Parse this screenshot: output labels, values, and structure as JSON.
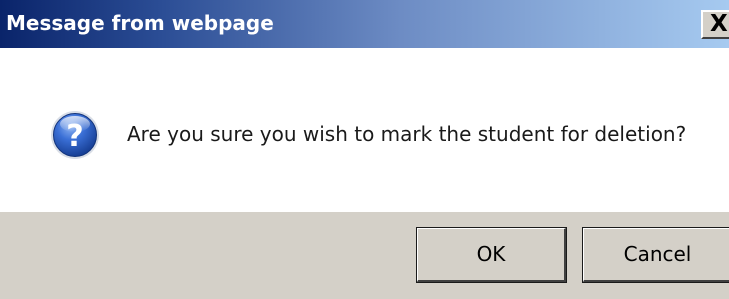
{
  "window": {
    "title": "Message from webpage",
    "close_symbol": "X"
  },
  "message": {
    "icon": "question-icon",
    "text": "Are you sure you wish to mark the student for deletion?"
  },
  "buttons": {
    "ok_label": "OK",
    "cancel_label": "Cancel"
  },
  "colors": {
    "title_gradient_start": "#0a246a",
    "title_gradient_end": "#a6caf0",
    "button_face": "#d4d0c8",
    "icon_blue": "#2a5bc4"
  }
}
